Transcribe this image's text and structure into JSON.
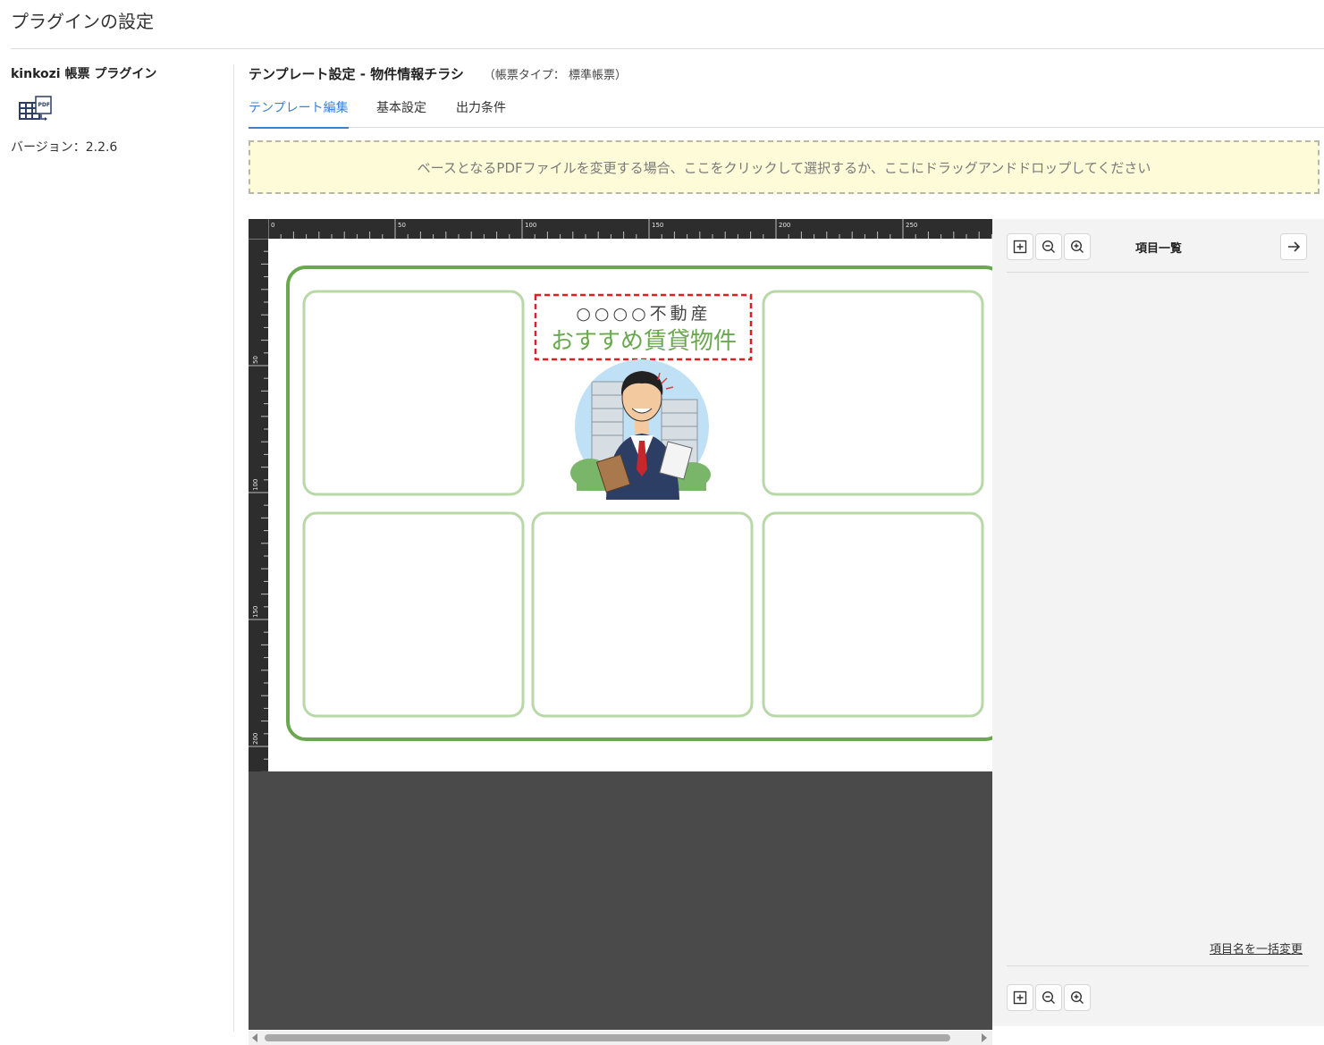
{
  "page": {
    "title": "プラグインの設定"
  },
  "sidebar": {
    "plugin_name": "kinkozi 帳票 プラグイン",
    "icon": "pdf-table-icon",
    "version": "バージョン：2.2.6"
  },
  "main": {
    "template_title": "テンプレート設定 - 物件情報チラシ",
    "template_type": "（帳票タイプ： 標準帳票）",
    "tabs": [
      {
        "label": "テンプレート編集",
        "active": true
      },
      {
        "label": "基本設定",
        "active": false
      },
      {
        "label": "出力条件",
        "active": false
      }
    ],
    "dropzone_text": "ベースとなるPDFファイルを変更する場合、ここをクリックして選択するか、ここにドラッグアンドドロップしてください"
  },
  "canvas": {
    "ruler_top_labels": [
      "0",
      "50",
      "100",
      "150",
      "200",
      "250"
    ],
    "ruler_left_labels": [
      "50",
      "100",
      "150",
      "200"
    ],
    "flyer": {
      "company": "○○○○不動産",
      "headline": "おすすめ賃貸物件"
    }
  },
  "right_panel": {
    "title": "項目一覧",
    "bulk_rename": "項目名を一括変更",
    "icons": [
      "fit-page-icon",
      "zoom-out-icon",
      "zoom-in-icon",
      "arrow-right-icon"
    ]
  },
  "colors": {
    "accent": "#3b82d6",
    "dropzone_bg": "#fdfbd8",
    "flyer_green": "#6aa84f",
    "flyer_frame_light": "#b8d8a8",
    "editor_bg": "#4a4a4a",
    "panel_bg": "#f3f3f3",
    "highlight_red": "#e02020"
  }
}
